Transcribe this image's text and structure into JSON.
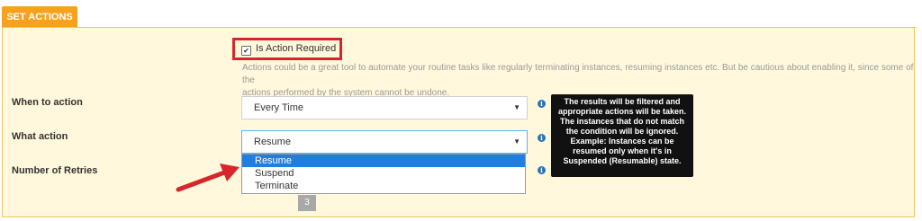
{
  "section": {
    "tab_label": "SET ACTIONS"
  },
  "action_required": {
    "label": "Is Action Required",
    "checked": true,
    "check_glyph": "✔",
    "help_line1": "Actions could be a great tool to automate your routine tasks like regularly terminating instances, resuming instances etc. But be cautious about enabling it, since some of the",
    "help_line2": "actions performed by the system cannot be undone."
  },
  "when_to_action": {
    "label": "When to action",
    "value": "Every Time",
    "info_icon": "info-icon"
  },
  "what_action": {
    "label": "What action",
    "value": "Resume",
    "options": [
      "Resume",
      "Suspend",
      "Terminate"
    ],
    "selected_option": "Resume",
    "info_icon": "info-icon"
  },
  "number_of_retries": {
    "label": "Number of Retries",
    "value": "3",
    "info_icon": "info-icon"
  },
  "tooltip": {
    "lines": [
      "The results will be filtered and",
      "appropriate actions will be taken.",
      "The instances that do not match",
      "the condition will be ignored.",
      "Example: Instances can be",
      "resumed only when it's in",
      "Suspended (Resumable) state."
    ]
  },
  "colors": {
    "accent_tab": "#f7a21a",
    "panel_bg": "#fff8dc",
    "highlight_box": "#d7262b",
    "dropdown_selected": "#1e7fe3",
    "annotation_arrow": "#d7262b"
  },
  "glyphs": {
    "caret": "▼",
    "info": "i"
  }
}
